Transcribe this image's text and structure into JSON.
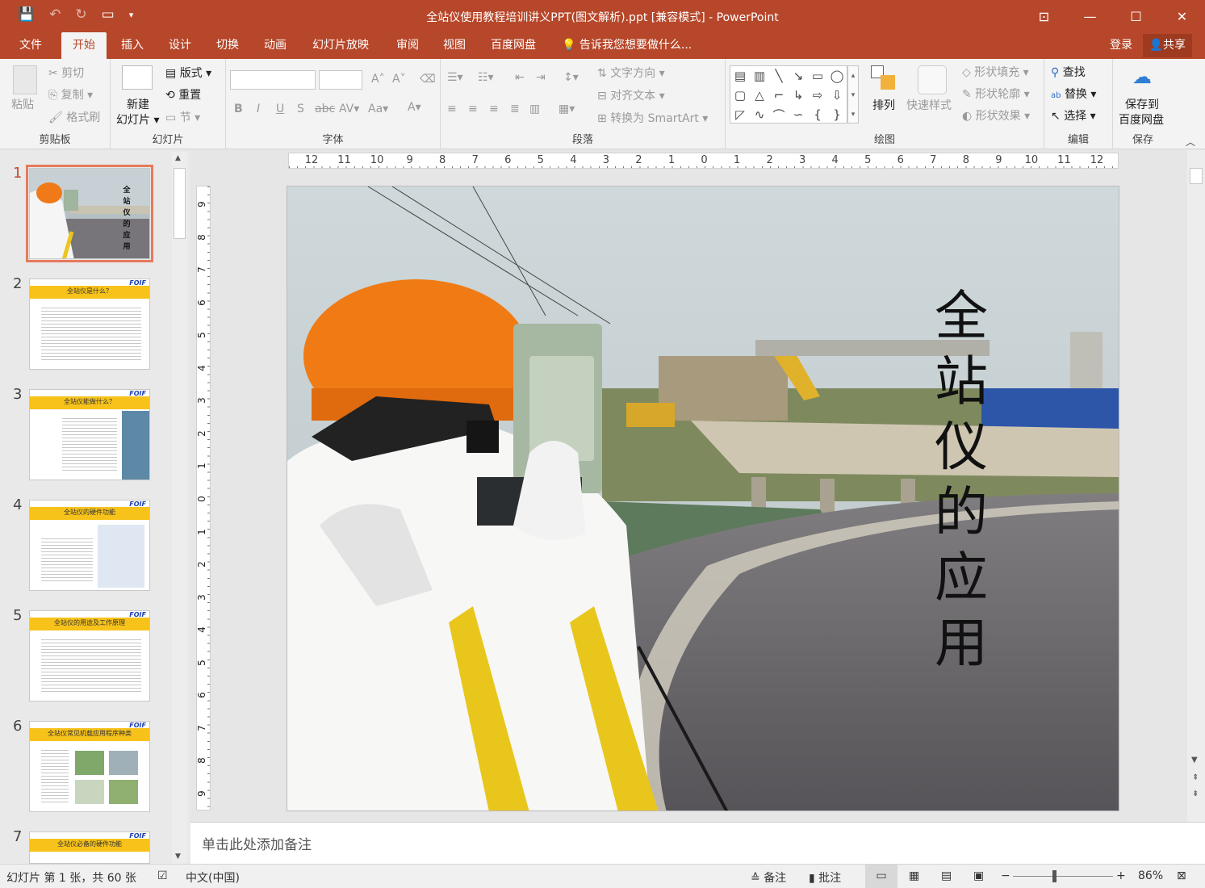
{
  "window": {
    "title": "全站仪使用教程培训讲义PPT(图文解析).ppt [兼容模式] - PowerPoint"
  },
  "tabs": [
    "文件",
    "开始",
    "插入",
    "设计",
    "切换",
    "动画",
    "幻灯片放映",
    "审阅",
    "视图",
    "百度网盘"
  ],
  "tell_me": "告诉我您想要做什么...",
  "account": {
    "login": "登录",
    "share": "共享"
  },
  "ribbon": {
    "clipboard": {
      "label": "剪贴板",
      "paste": "粘贴",
      "cut": "剪切",
      "copy": "复制",
      "format_painter": "格式刷"
    },
    "slides": {
      "label": "幻灯片",
      "new_slide": "新建",
      "new_slide2": "幻灯片",
      "layout": "版式",
      "reset": "重置",
      "section": "节"
    },
    "font": {
      "label": "字体"
    },
    "paragraph": {
      "label": "段落",
      "text_direction": "文字方向",
      "align_text": "对齐文本",
      "smartart": "转换为 SmartArt"
    },
    "drawing": {
      "label": "绘图",
      "arrange": "排列",
      "quick_styles": "快速样式",
      "shape_fill": "形状填充",
      "shape_outline": "形状轮廓",
      "shape_effects": "形状效果"
    },
    "editing": {
      "label": "编辑",
      "find": "查找",
      "replace": "替换",
      "select": "选择"
    },
    "save": {
      "label": "保存",
      "save_to": "保存到",
      "baidu": "百度网盘"
    }
  },
  "slides": [
    {
      "num": "1",
      "title": "全站仪的应用"
    },
    {
      "num": "2",
      "title": "全站仪是什么？"
    },
    {
      "num": "3",
      "title": "全站仪能做什么？"
    },
    {
      "num": "4",
      "title": "全站仪的硬件功能"
    },
    {
      "num": "5",
      "title": "全站仪的用途及工作原理"
    },
    {
      "num": "6",
      "title": "全站仪常见机载应用程序种类"
    },
    {
      "num": "7",
      "title": "全站仪必备的硬件功能"
    }
  ],
  "thumb_logo": "FOIF",
  "ruler": {
    "h": [
      "12",
      "11",
      "10",
      "9",
      "8",
      "7",
      "6",
      "5",
      "4",
      "3",
      "2",
      "1",
      "0",
      "1",
      "2",
      "3",
      "4",
      "5",
      "6",
      "7",
      "8",
      "9",
      "10",
      "11",
      "12"
    ],
    "v": [
      "9",
      "8",
      "7",
      "6",
      "5",
      "4",
      "3",
      "2",
      "1",
      "0",
      "1",
      "2",
      "3",
      "4",
      "5",
      "6",
      "7",
      "8",
      "9"
    ]
  },
  "current_slide": {
    "title_chars": [
      "全",
      "站",
      "仪",
      "的",
      "应",
      "用"
    ]
  },
  "notes_placeholder": "单击此处添加备注",
  "status": {
    "slide_info": "幻灯片 第 1 张，共 60 张",
    "language": "中文(中国)",
    "notes": "备注",
    "comments": "批注",
    "zoom": "86%"
  }
}
